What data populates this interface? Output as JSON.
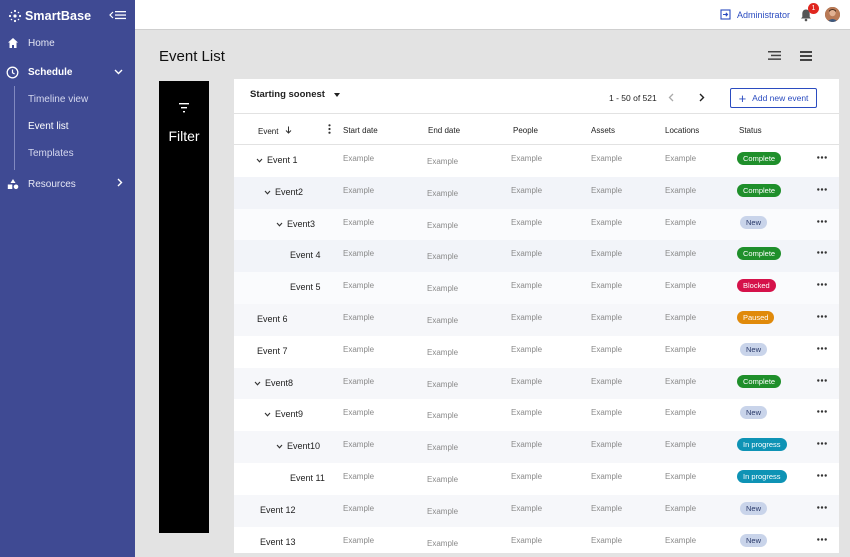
{
  "app": {
    "brand": "SmartBase",
    "admin_label": "Administrator",
    "notification_count": "1"
  },
  "sidebar": {
    "items": [
      {
        "label": "Home",
        "icon": "home-icon"
      },
      {
        "label": "Schedule",
        "icon": "clock-icon"
      },
      {
        "label": "Resources",
        "icon": "resources-icon"
      }
    ],
    "sub_items": [
      {
        "label": "Timeline view"
      },
      {
        "label": "Event list"
      },
      {
        "label": "Templates"
      }
    ]
  },
  "page": {
    "title": "Event List"
  },
  "filter": {
    "label": "Filter"
  },
  "toolbar": {
    "sort_label": "Starting soonest",
    "pager_text": "1 - 50 of 521",
    "add_label": "Add new event"
  },
  "table": {
    "headers": [
      "Event",
      "Start date",
      "End date",
      "People",
      "Assets",
      "Locations",
      "Status"
    ],
    "rows": [
      {
        "event": "Event 1",
        "start": "Example",
        "end": "Example",
        "people": "Example",
        "assets": "Example",
        "locations": "Example",
        "status": "Complete"
      },
      {
        "event": "Event2",
        "start": "Example",
        "end": "Example",
        "people": "Example",
        "assets": "Example",
        "locations": "Example",
        "status": "Complete"
      },
      {
        "event": "Event3",
        "start": "Example",
        "end": "Example",
        "people": "Example",
        "assets": "Example",
        "locations": "Example",
        "status": "New"
      },
      {
        "event": "Event 4",
        "start": "Example",
        "end": "Example",
        "people": "Example",
        "assets": "Example",
        "locations": "Example",
        "status": "Complete"
      },
      {
        "event": "Event 5",
        "start": "Example",
        "end": "Example",
        "people": "Example",
        "assets": "Example",
        "locations": "Example",
        "status": "Blocked"
      },
      {
        "event": "Event 6",
        "start": "Example",
        "end": "Example",
        "people": "Example",
        "assets": "Example",
        "locations": "Example",
        "status": "Paused"
      },
      {
        "event": "Event 7",
        "start": "Example",
        "end": "Example",
        "people": "Example",
        "assets": "Example",
        "locations": "Example",
        "status": "New"
      },
      {
        "event": "Event8",
        "start": "Example",
        "end": "Example",
        "people": "Example",
        "assets": "Example",
        "locations": "Example",
        "status": "Complete"
      },
      {
        "event": "Event9",
        "start": "Example",
        "end": "Example",
        "people": "Example",
        "assets": "Example",
        "locations": "Example",
        "status": "New"
      },
      {
        "event": "Event10",
        "start": "Example",
        "end": "Example",
        "people": "Example",
        "assets": "Example",
        "locations": "Example",
        "status": "In progress"
      },
      {
        "event": "Event 11",
        "start": "Example",
        "end": "Example",
        "people": "Example",
        "assets": "Example",
        "locations": "Example",
        "status": "In progress"
      },
      {
        "event": "Event 12",
        "start": "Example",
        "end": "Example",
        "people": "Example",
        "assets": "Example",
        "locations": "Example",
        "status": "New"
      },
      {
        "event": "Event 13",
        "start": "Example",
        "end": "Example",
        "people": "Example",
        "assets": "Example",
        "locations": "Example",
        "status": "New"
      }
    ]
  },
  "colors": {
    "sidebar": "#3f4a93",
    "accent": "#2b4cc0",
    "Complete": "#1f8f2b",
    "New": "#c9d4ea",
    "Blocked": "#d5124a",
    "Paused": "#e08a0b",
    "In progress": "#0e93b5"
  }
}
